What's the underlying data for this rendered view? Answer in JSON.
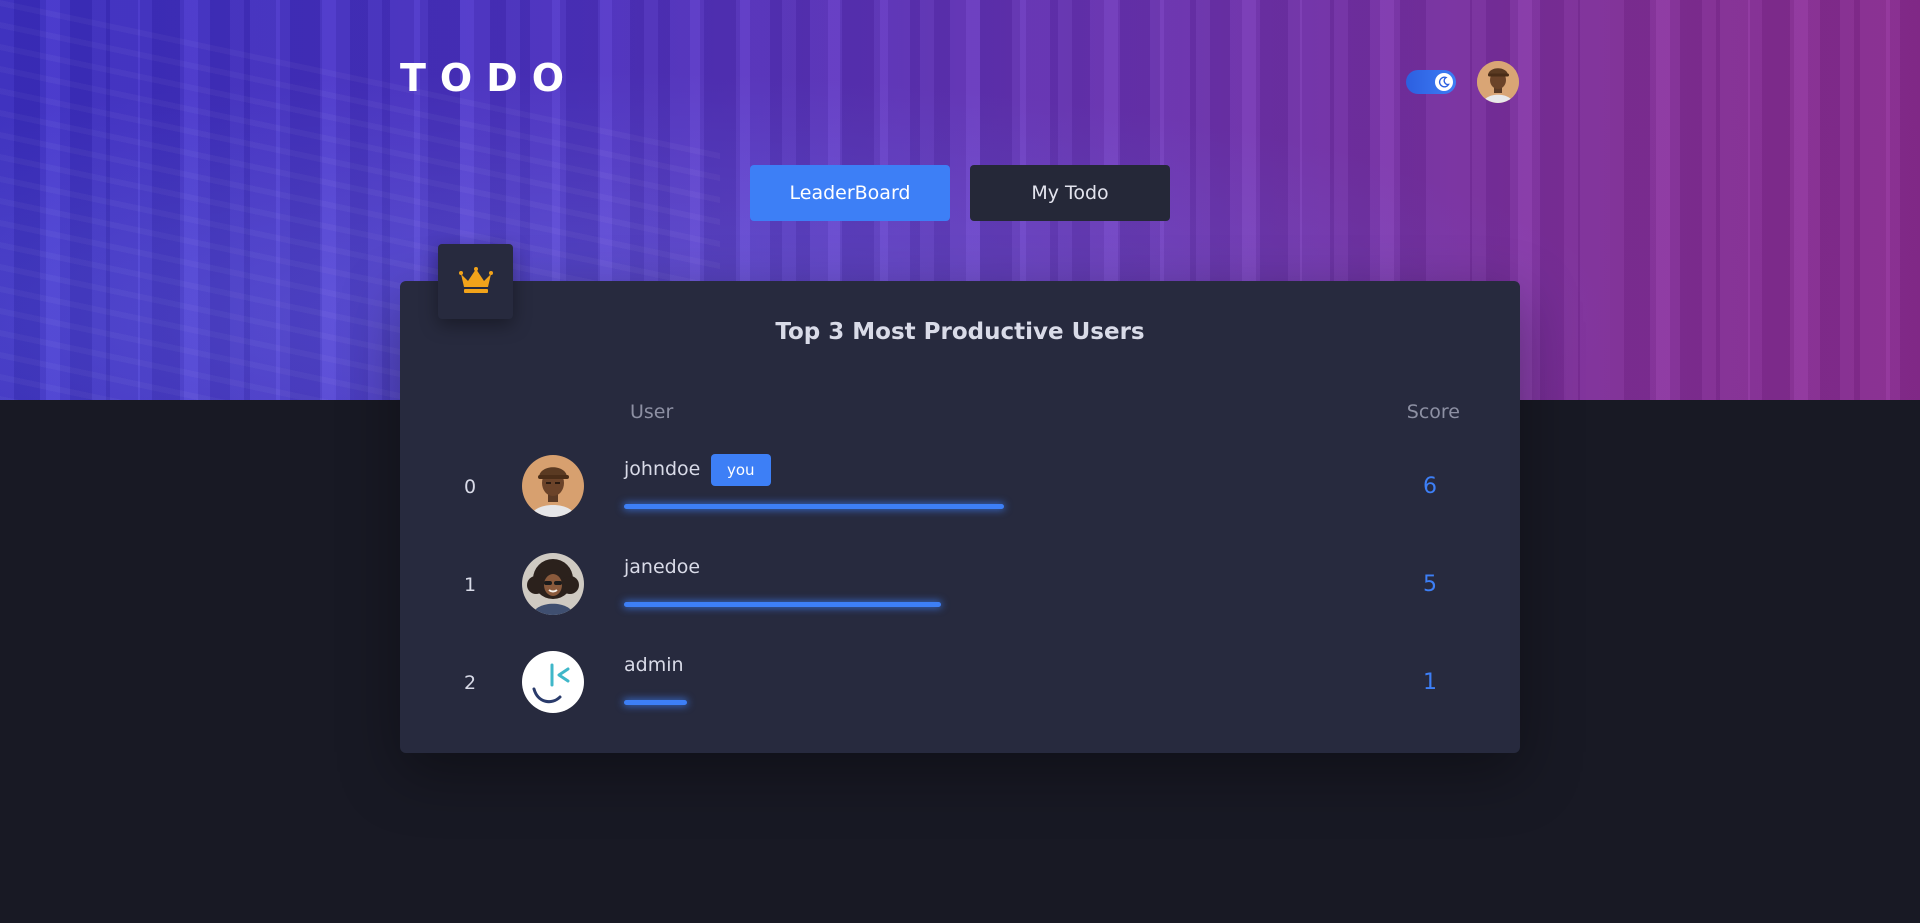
{
  "header": {
    "logo": "TODO",
    "theme_toggle_icon": "moon-icon",
    "avatar_icon": "user-avatar"
  },
  "tabs": [
    {
      "label": "LeaderBoard",
      "active": true
    },
    {
      "label": "My Todo",
      "active": false
    }
  ],
  "leaderboard": {
    "badge_icon": "crown-icon",
    "title": "Top 3 Most Productive Users",
    "columns": {
      "user": "User",
      "score": "Score"
    },
    "you_label": "you",
    "max_score": 6,
    "rows": [
      {
        "rank": "0",
        "username": "johndoe",
        "score": "6",
        "is_you": true,
        "avatar": "man-cap-avatar"
      },
      {
        "rank": "1",
        "username": "janedoe",
        "score": "5",
        "is_you": false,
        "avatar": "woman-curly-avatar"
      },
      {
        "rank": "2",
        "username": "admin",
        "score": "1",
        "is_you": false,
        "avatar": "app-logo-avatar"
      }
    ]
  },
  "colors": {
    "accent": "#3d7ff6",
    "card": "#272a3e",
    "background": "#181924",
    "crown": "#f2a31a"
  }
}
